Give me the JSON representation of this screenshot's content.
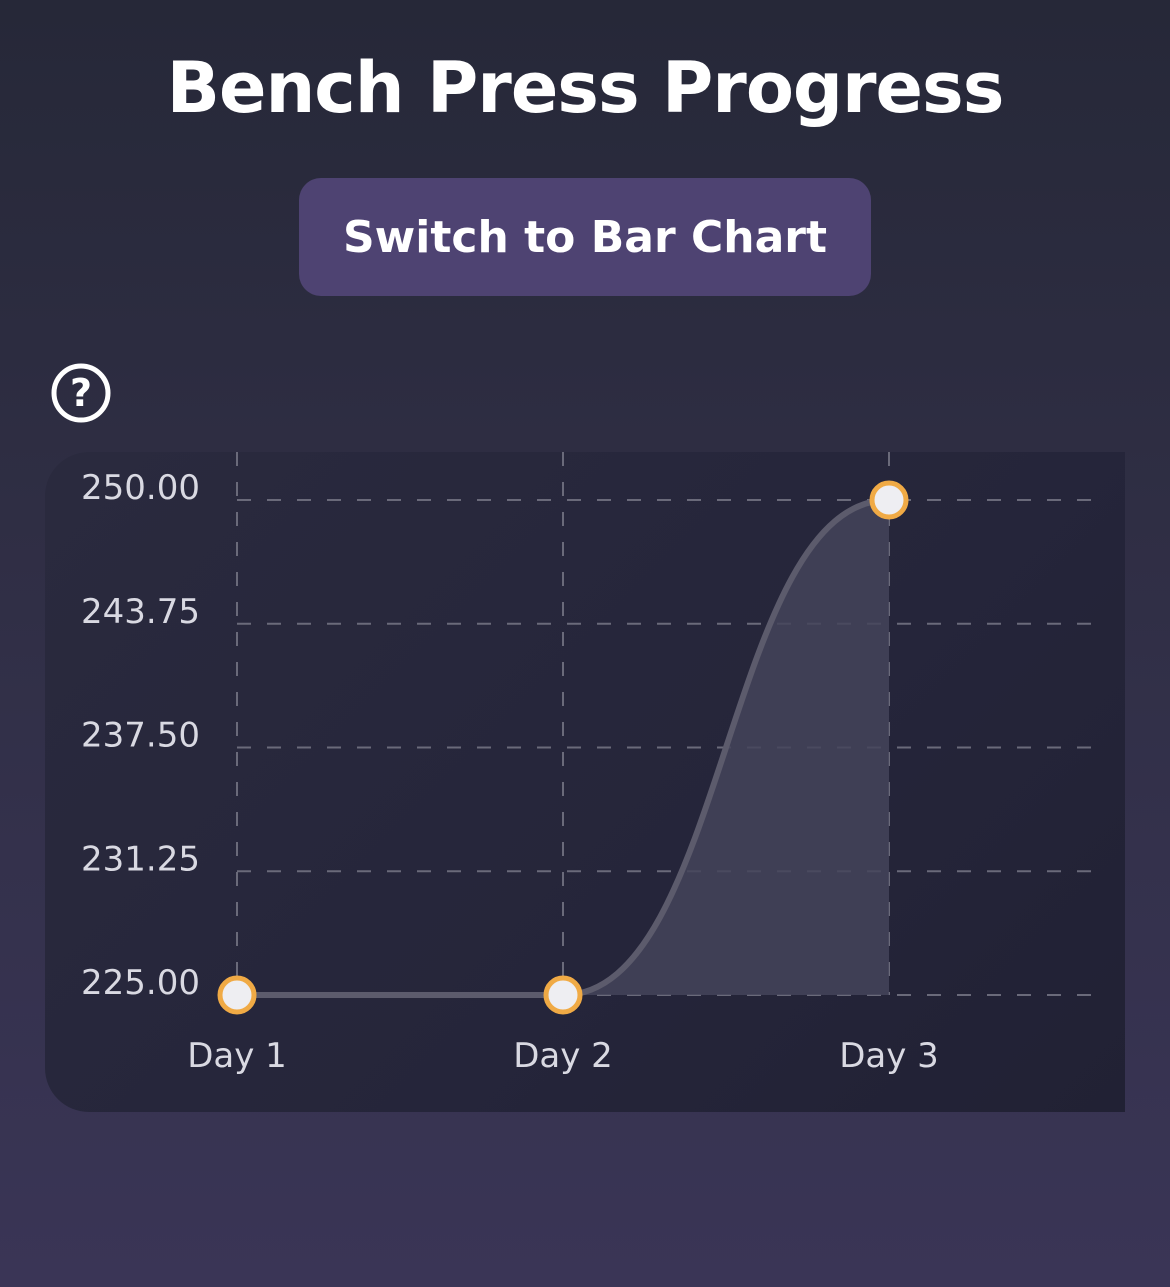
{
  "header": {
    "title": "Bench Press Progress"
  },
  "controls": {
    "switch_label": "Switch to Bar Chart",
    "help_icon": "question-circle-icon"
  },
  "colors": {
    "line": "#5c5b6c",
    "area_fill": "#44445a",
    "point_fill": "#eeeef2",
    "point_stroke": "#f0aa45",
    "grid": "#6a6a7a",
    "button_bg": "#4e4372"
  },
  "chart_data": {
    "type": "line",
    "title": "",
    "xlabel": "",
    "ylabel": "",
    "categories": [
      "Day 1",
      "Day 2",
      "Day 3"
    ],
    "series": [
      {
        "values": [
          225,
          225,
          250
        ]
      }
    ],
    "y_ticks": [
      "225.00",
      "231.25",
      "237.50",
      "243.75",
      "250.00"
    ],
    "ylim": [
      225,
      250
    ],
    "grid": true,
    "curve": "smooth",
    "area_fill_under_last_segment": true
  }
}
